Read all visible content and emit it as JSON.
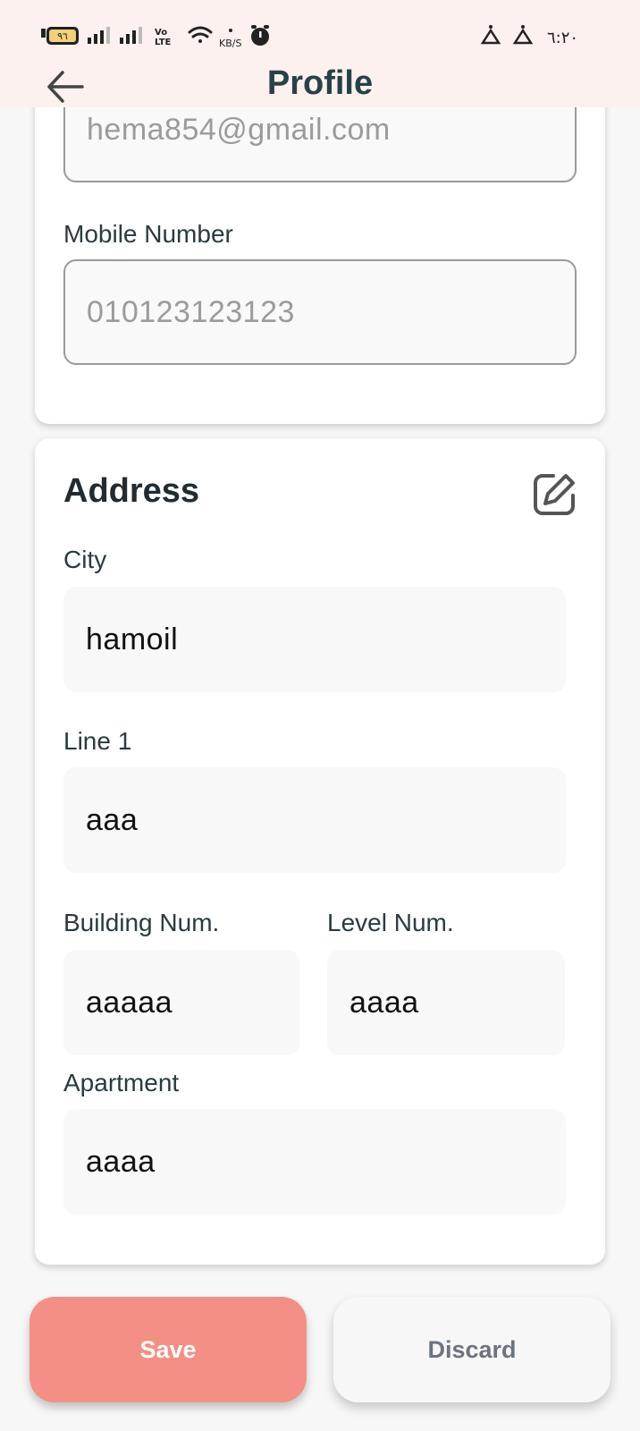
{
  "status_bar": {
    "battery": "٩٦",
    "network": "KB/S",
    "volte": "Vo LTE",
    "time": "٦:٢٠"
  },
  "header": {
    "title": "Profile",
    "back_icon": "arrow-left-icon"
  },
  "contact": {
    "email_value": "hema854@gmail.com",
    "mobile_label": "Mobile Number",
    "mobile_value": "010123123123"
  },
  "address": {
    "title": "Address",
    "edit_icon": "edit-icon",
    "city_label": "City",
    "city_value": "hamoil",
    "line1_label": "Line 1",
    "line1_value": "aaa",
    "building_label": "Building Num.",
    "building_value": "aaaaa",
    "level_label": "Level Num.",
    "level_value": "aaaa",
    "apartment_label": "Apartment",
    "apartment_value": "aaaa"
  },
  "actions": {
    "save_label": "Save",
    "discard_label": "Discard"
  },
  "colors": {
    "header_bg": "#fcf1ee",
    "title": "#274247",
    "save_bg": "#f38f85",
    "discard_text": "#6c7480"
  }
}
